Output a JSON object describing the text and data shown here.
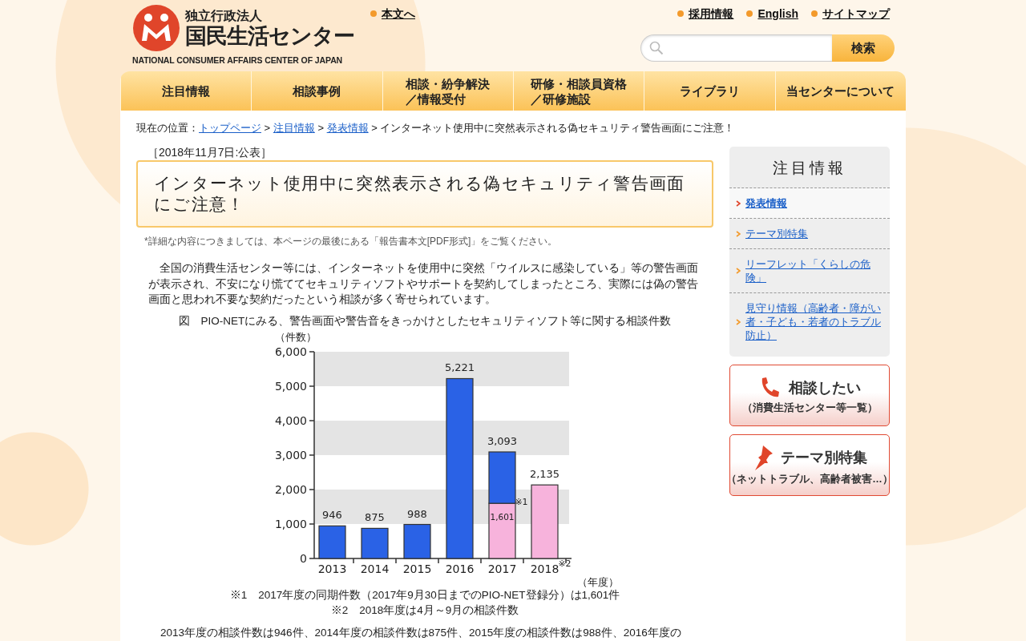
{
  "header": {
    "logo": {
      "org_type": "独立行政法人",
      "name": "国民生活センター",
      "english": "NATIONAL CONSUMER AFFAIRS CENTER OF JAPAN"
    },
    "skip_link": "本文へ",
    "top_links": [
      "採用情報",
      "English",
      "サイトマップ"
    ],
    "search": {
      "button": "検索"
    }
  },
  "nav": [
    {
      "lines": [
        "注目情報"
      ]
    },
    {
      "lines": [
        "相談事例"
      ]
    },
    {
      "lines": [
        "相談・紛争解決",
        "／情報受付"
      ]
    },
    {
      "lines": [
        "研修・相談員資格",
        "／研修施設"
      ]
    },
    {
      "lines": [
        "ライブラリ"
      ]
    },
    {
      "lines": [
        "当センターについて"
      ]
    }
  ],
  "breadcrumb": {
    "prefix": "現在の位置：",
    "separator": ">",
    "links": [
      "トップページ",
      "注目情報",
      "発表情報"
    ],
    "current": "インターネット使用中に突然表示される偽セキュリティ警告画面にご注意！"
  },
  "article": {
    "date": "［2018年11月7日:公表］",
    "title": "インターネット使用中に突然表示される偽セキュリティ警告画面にご注意！",
    "note": "*詳細な内容につきましては、本ページの最後にある「報告書本文[PDF形式]」をご覧ください。",
    "body": "　全国の消費生活センター等には、インターネットを使用中に突然「ウイルスに感染している」等の警告画面が表示され、不安になり慌ててセキュリティソフトやサポートを契約してしまったところ、実際には偽の警告画面と思われ不要な契約だったという相談が多く寄せられています。",
    "figure_caption": "図　PIO-NETにみる、警告画面や警告音をきっかけとしたセキュリティソフト等に関する相談件数",
    "chart_data": {
      "type": "bar",
      "ylabel": "（件数）",
      "xlabel": "（年度）",
      "categories": [
        "2013",
        "2014",
        "2015",
        "2016",
        "2017",
        "2018"
      ],
      "series": [
        {
          "color": "#f7b3dc",
          "values": [
            null,
            null,
            null,
            null,
            1601,
            2135
          ]
        },
        {
          "color": "#2a62e6",
          "values": [
            946,
            875,
            988,
            5221,
            1492,
            null
          ]
        }
      ],
      "stacked": true,
      "ylim": [
        0,
        6000
      ],
      "yticks": [
        {
          "value": 0,
          "label": "0"
        },
        {
          "value": 1000,
          "label": "1,000"
        },
        {
          "value": 2000,
          "label": "2,000"
        },
        {
          "value": 3000,
          "label": "3,000"
        },
        {
          "value": 4000,
          "label": "4,000"
        },
        {
          "value": 5000,
          "label": "5,000"
        },
        {
          "value": 6000,
          "label": "6,000"
        }
      ],
      "value_labels": [
        "946",
        "875",
        "988",
        "5,221",
        "3,093",
        "2,135"
      ],
      "annotations": [
        "1,601",
        "※1",
        "※2"
      ]
    },
    "footnotes": [
      "※1　2017年度の同期件数（2017年9月30日までのPIO-NET登録分）は1,601件",
      "※2　2018年度は4月～9月の相談件数"
    ],
    "summary": "2013年度の相談件数は946件、2014年度の相談件数は875件、2015年度の相談件数は988件、2016年度の"
  },
  "sidebar": {
    "title": "注目情報",
    "items": [
      {
        "label": "発表情報",
        "selected": true
      },
      {
        "label": "テーマ別特集",
        "selected": false
      },
      {
        "label": "リーフレット「くらしの危険」",
        "selected": false
      },
      {
        "label": "見守り情報（高齢者・障がい者・子ども・若者のトラブル防止）",
        "selected": false
      }
    ],
    "banners": [
      {
        "kind": "phone",
        "title": "相談したい",
        "subtitle": "（消費生活センター等一覧）"
      },
      {
        "kind": "pin",
        "title": "テーマ別特集",
        "subtitle": "（ネットトラブル、高齢者被害…）"
      }
    ]
  }
}
